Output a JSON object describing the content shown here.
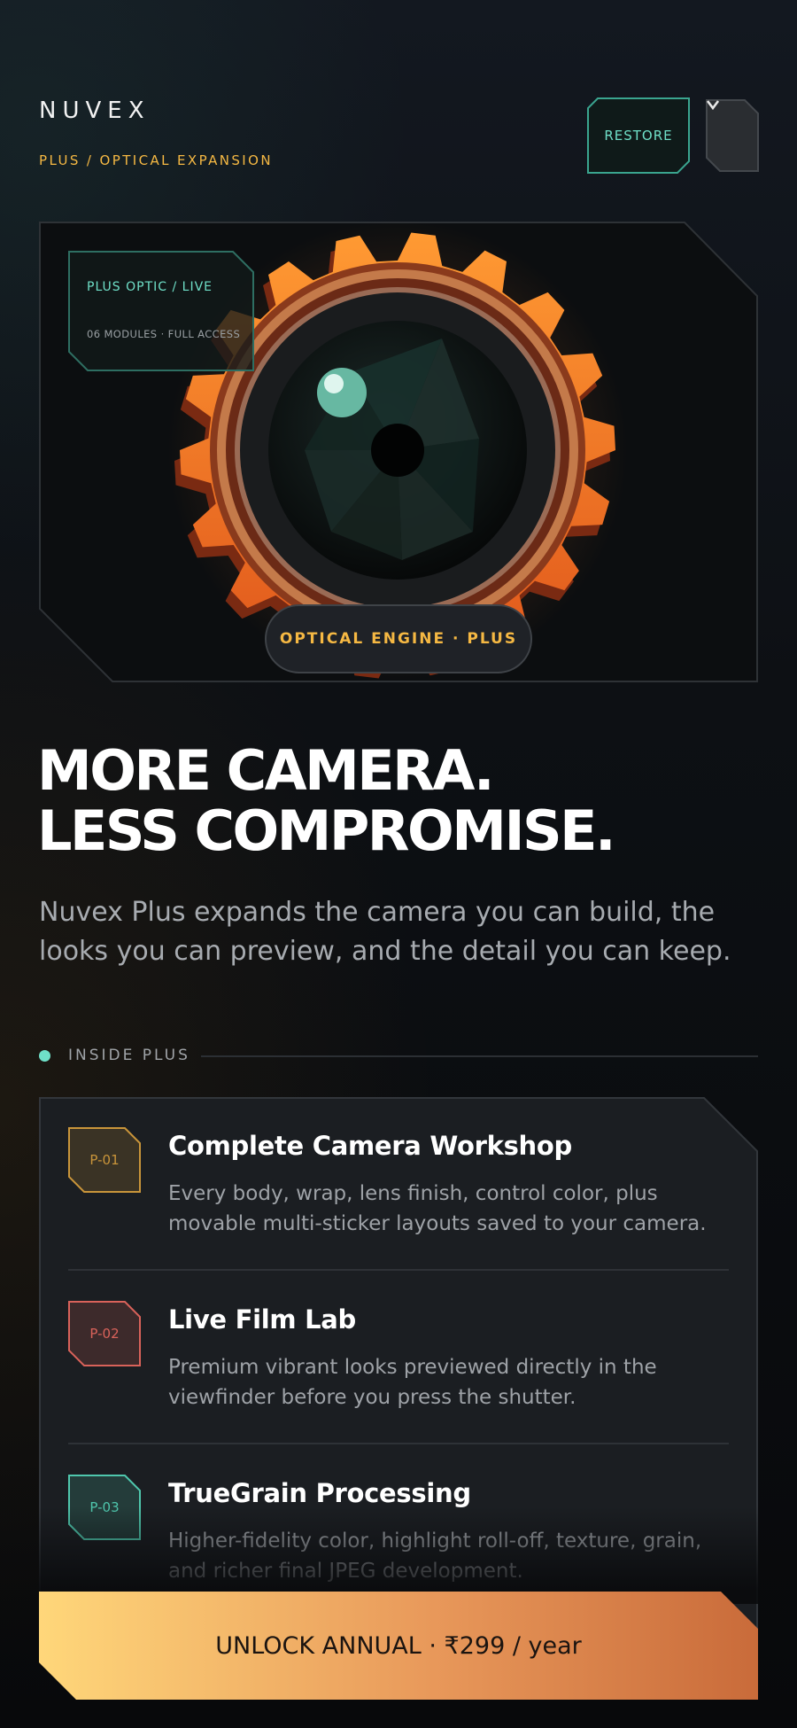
{
  "header": {
    "brand": "NUVEX",
    "subtitle": "PLUS / OPTICAL EXPANSION",
    "restore_label": "RESTORE",
    "menu_icon": "chevron-down-icon"
  },
  "hero": {
    "tag_title": "PLUS OPTIC / LIVE",
    "tag_meta": "06 MODULES · FULL ACCESS",
    "engine_label": "OPTICAL ENGINE · PLUS"
  },
  "headline": {
    "line1": "MORE CAMERA.",
    "line2": "LESS COMPROMISE."
  },
  "lede": "Nuvex Plus expands the camera you can build, the looks you can preview, and the detail you can keep.",
  "section": {
    "label": "INSIDE PLUS"
  },
  "features": [
    {
      "code": "P-01",
      "title": "Complete Camera Workshop",
      "desc": "Every body, wrap, lens finish, control color, plus movable multi-sticker layouts saved to your camera.",
      "color": "#c9953a"
    },
    {
      "code": "P-02",
      "title": "Live Film Lab",
      "desc": "Premium vibrant looks previewed directly in the viewfinder before you press the shutter.",
      "color": "#d9625a"
    },
    {
      "code": "P-03",
      "title": "TrueGrain Processing",
      "desc": "Higher-fidelity color, highlight roll-off, texture, grain, and richer final JPEG development.",
      "color": "#4fc7ad"
    }
  ],
  "cta": {
    "label": "UNLOCK ANNUAL · ₹299 / year"
  },
  "colors": {
    "accent_teal": "#6fe0c8",
    "accent_amber": "#f5b843",
    "gear_orange": "#f07a26",
    "cta_start": "#ffd77a",
    "cta_end": "#c96b3a"
  }
}
